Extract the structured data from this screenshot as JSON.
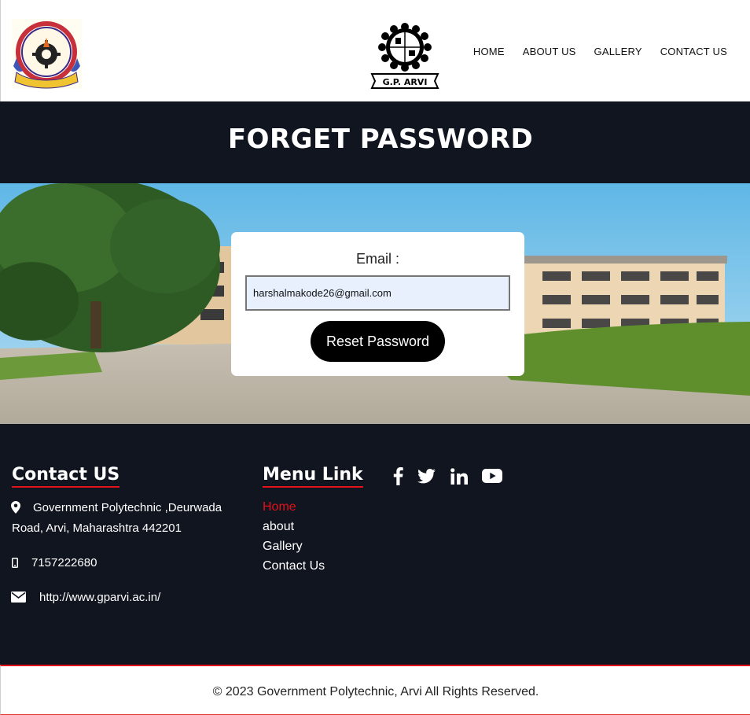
{
  "header": {
    "nav": [
      "HOME",
      "ABOUT US",
      "GALLERY",
      "CONTACT US"
    ],
    "center_logo_text": "G.P. ARVI"
  },
  "page": {
    "title": "FORGET PASSWORD"
  },
  "form": {
    "email_label": "Email :",
    "email_value": "harshalmakode26@gmail.com",
    "submit_label": "Reset Password"
  },
  "footer": {
    "contact_title": "Contact US",
    "address_line1": "Government Polytechnic ,Deurwada",
    "address_line2": "Road, Arvi, Maharashtra 442201",
    "phone": "7157222680",
    "website": "http://www.gparvi.ac.in/",
    "menu_title": "Menu Link",
    "menu_links": [
      "Home",
      "about",
      "Gallery",
      "Contact Us"
    ],
    "social_icons": [
      "facebook-icon",
      "twitter-icon",
      "linkedin-icon",
      "youtube-icon"
    ]
  },
  "copyright": "© 2023 Government Polytechnic, Arvi All Rights Reserved.",
  "colors": {
    "dark_band": "#111520",
    "accent_red": "#e2121a",
    "button_black": "#000000",
    "input_bg": "#e8f0fe"
  }
}
